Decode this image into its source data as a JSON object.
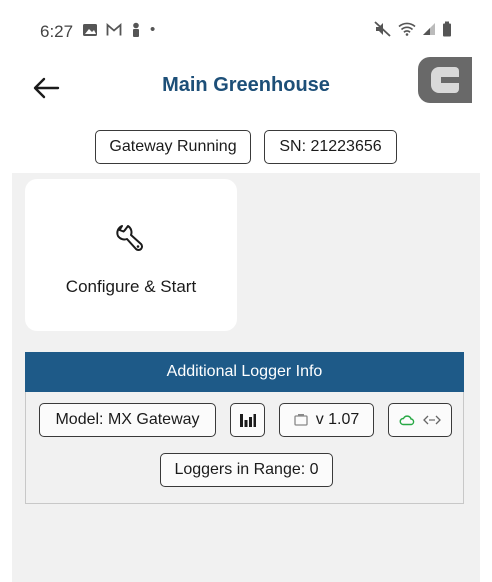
{
  "status_bar": {
    "time": "6:27",
    "notification_icons": [
      "image-icon",
      "gmail-icon",
      "person-icon"
    ],
    "dot": "•",
    "right_icons": [
      "mute-icon",
      "wifi-icon",
      "signal-icon",
      "battery-icon"
    ]
  },
  "app_bar": {
    "title": "Main Greenhouse",
    "back_icon": "arrow-left-icon"
  },
  "chips": {
    "gateway_status": "Gateway Running",
    "serial_number": "SN: 21223656"
  },
  "configure_card": {
    "icon": "wrench-icon",
    "label": "Configure & Start"
  },
  "logger_info": {
    "header": "Additional Logger Info",
    "model": "Model: MX Gateway",
    "signal_icon": "signal-bars-icon",
    "firmware_icon": "battery-outline-icon",
    "firmware": "v  1.07",
    "cloud_icons": [
      "cloud-icon",
      "link-arrows-icon"
    ],
    "loggers_in_range": "Loggers in Range: 0"
  },
  "colors": {
    "title": "#1d4f78",
    "header_bg": "#1e5a88",
    "content_bg": "#f1f1f1",
    "cloud_accent": "#27a844",
    "overlay_button": "#696969"
  }
}
